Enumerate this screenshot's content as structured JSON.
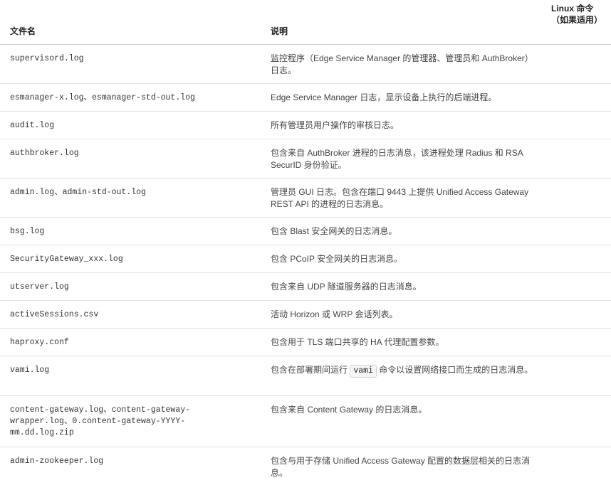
{
  "header": {
    "file_col": "文件名",
    "desc_col": "说明",
    "cmd_col": "Linux 命令（如果适用）"
  },
  "rows": [
    {
      "file": "supervisord.log",
      "desc": "监控程序（Edge Service Manager 的管理器、管理员和 AuthBroker）日志。"
    },
    {
      "file": "esmanager-x.log、esmanager-std-out.log",
      "desc": "Edge Service Manager 日志，显示设备上执行的后端进程。"
    },
    {
      "file": "audit.log",
      "desc": "所有管理员用户操作的审核日志。"
    },
    {
      "file": "authbroker.log",
      "desc": "包含来自 AuthBroker 进程的日志消息，该进程处理 Radius 和 RSA SecurID 身份验证。"
    },
    {
      "file": "admin.log、admin-std-out.log",
      "desc": "管理员 GUI 日志。包含在端口 9443 上提供 Unified Access Gateway REST API 的进程的日志消息。"
    },
    {
      "file": "bsg.log",
      "desc": "包含 Blast 安全网关的日志消息。"
    },
    {
      "file": "SecurityGateway_xxx.log",
      "desc": "包含 PCoIP 安全网关的日志消息。"
    },
    {
      "file": "utserver.log",
      "desc": "包含来自 UDP 隧道服务器的日志消息。"
    },
    {
      "file": "activeSessions.csv",
      "desc": "活动 Horizon 或 WRP 会话列表。"
    },
    {
      "file": "haproxy.conf",
      "desc": "包含用于 TLS 端口共享的 HA 代理配置参数。"
    },
    {
      "file": "vami.log",
      "desc_before": "包含在部署期间运行 ",
      "desc_code": "vami",
      "desc_after": " 命令以设置网络接口而生成的日志消息。"
    },
    {
      "file": "content-gateway.log、content-gateway-wrapper.log、0.content-gateway-YYYY-mm.dd.log.zip",
      "desc": "包含来自 Content Gateway 的日志消息。"
    },
    {
      "file": "admin-zookeeper.log",
      "desc": "包含与用于存储 Unified Access Gateway 配置的数据层相关的日志消息。"
    }
  ]
}
